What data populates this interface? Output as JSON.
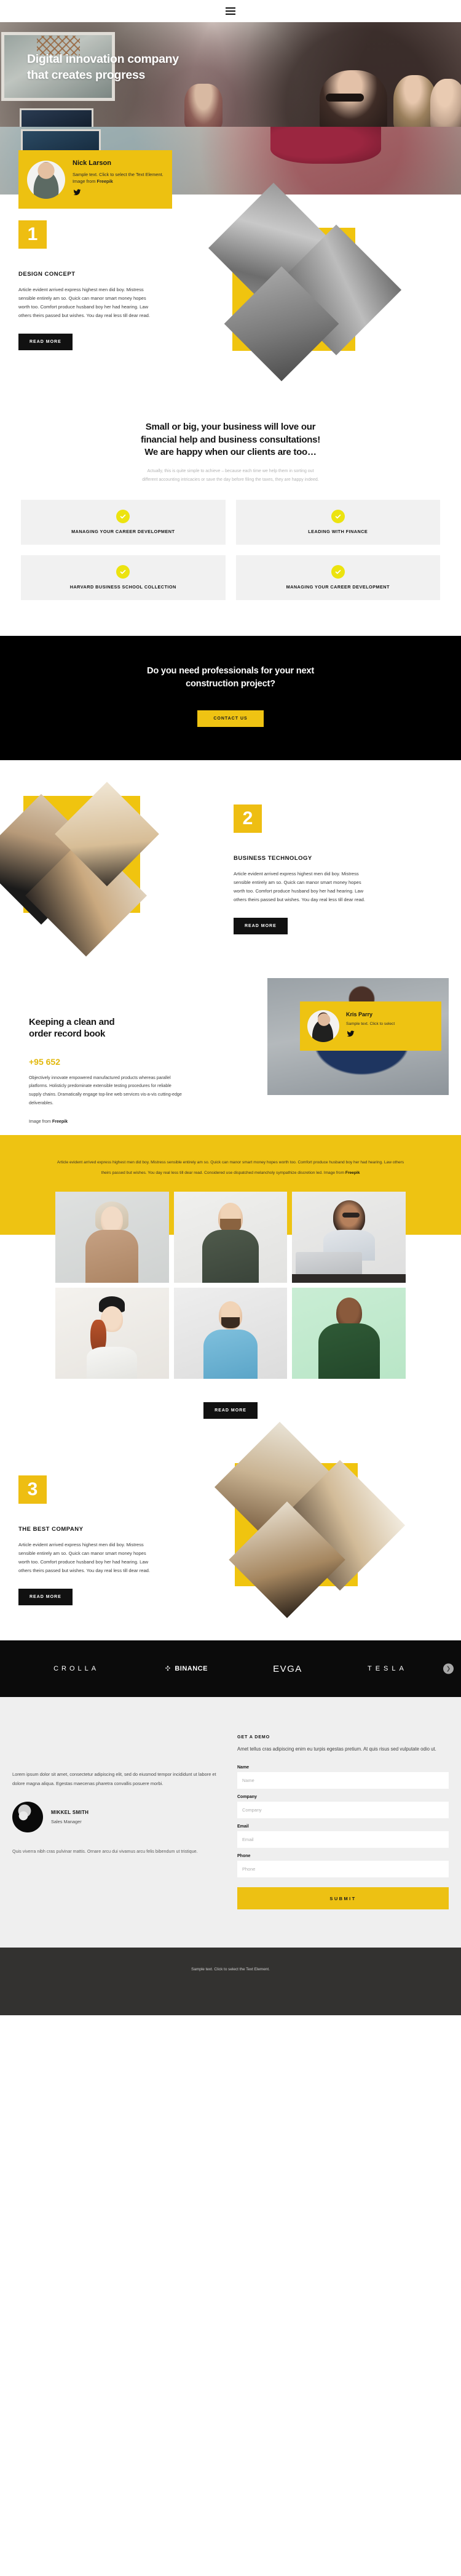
{
  "nav": {
    "menu_icon": "hamburger-icon"
  },
  "hero": {
    "title_line1": "Digital innovation company",
    "title_line2": "that creates progress",
    "card": {
      "name": "Nick Larson",
      "text": "Sample text. Click to select the Text Element. Image from ",
      "link": "Freepik",
      "social_icon": "twitter-icon"
    }
  },
  "section1": {
    "number": "1",
    "title": "DESIGN CONCEPT",
    "body": "Article evident arrived express highest men did boy. Mistress sensible entirely am so. Quick can manor smart money hopes worth too. Comfort produce husband boy her had hearing. Law others theirs passed but wishes. You day real less till dear read.",
    "button": "READ MORE"
  },
  "features": {
    "heading_line1": "Small or big, your business will love our",
    "heading_line2": "financial help and business consultations!",
    "heading_line3": "We are happy when our clients are too…",
    "sub_line1": "Actually, this is quite simple to achieve – because each time we help them in sorting out",
    "sub_line2": "different accounting intricacies or save the day before filing the taxes, they are happy indeed.",
    "items": [
      {
        "label": "MANAGING YOUR CAREER DEVELOPMENT",
        "icon": "check-icon"
      },
      {
        "label": "LEADING WITH FINANCE",
        "icon": "check-icon"
      },
      {
        "label": "HARVARD BUSINESS SCHOOL COLLECTION",
        "icon": "check-icon"
      },
      {
        "label": "MANAGING YOUR CAREER DEVELOPMENT",
        "icon": "check-icon"
      }
    ]
  },
  "cta": {
    "heading_line1": "Do you need professionals for your next",
    "heading_line2": "construction project?",
    "button": "CONTACT US"
  },
  "section2": {
    "number": "2",
    "title": "BUSINESS TECHNOLOGY",
    "body": "Article evident arrived express highest men did boy. Mistress sensible entirely am so. Quick can manor smart money hopes worth too. Comfort produce husband boy her had hearing. Law others theirs passed but wishes. You day real less till dear read.",
    "button": "READ MORE"
  },
  "record": {
    "heading_line1": "Keeping a clean and",
    "heading_line2": "order record book",
    "stat": "+95 652",
    "body": "Objectively innovate empowered manufactured products whereas parallel platforms. Holisticly predominate extensible testing procedures for reliable supply chains. Dramatically engage top-line web services vis-a-vis cutting-edge deliverables.",
    "credit_prefix": "Image from ",
    "credit_link": "Freepik",
    "card": {
      "name": "Kris Parry",
      "text": "Sample text. Click to select",
      "social_icon": "twitter-icon"
    }
  },
  "yellow_band": {
    "text": "Article evident arrived express highest men did boy. Mistress sensible entirely am so. Quick can manor smart money hopes worth too. Comfort produce husband boy her had hearing. Law others theirs passed but wishes. You day real less till dear read. Considered use dispatched melancholy sympathize discretion led. Image from ",
    "link": "Freepik"
  },
  "gallery": {
    "button": "READ MORE",
    "items": [
      {
        "alt": "woman-in-tan-sweater"
      },
      {
        "alt": "bearded-man-in-green-sweater"
      },
      {
        "alt": "woman-with-glasses-at-laptop"
      },
      {
        "alt": "woman-in-black-beanie"
      },
      {
        "alt": "man-in-blue-polo"
      },
      {
        "alt": "man-in-green-hoodie"
      }
    ]
  },
  "section3": {
    "number": "3",
    "title": "THE BEST COMPANY",
    "body": "Article evident arrived express highest men did boy. Mistress sensible entirely am so. Quick can manor smart money hopes worth too. Comfort produce husband boy her had hearing. Law others theirs passed but wishes. You day real less till dear read.",
    "button": "READ MORE"
  },
  "logos": [
    {
      "name": "CROLLA",
      "icon": ""
    },
    {
      "name": "BINANCE",
      "icon": "binance-diamond-icon"
    },
    {
      "name": "EVGA",
      "icon": ""
    },
    {
      "name": "TESLA",
      "icon": ""
    }
  ],
  "logos_next_icon": "chevron-right-icon",
  "footer": {
    "lorem": "Lorem ipsum dolor sit amet, consectetur adipiscing elit, sed do eiusmod tempor incididunt ut labore et dolore magna aliqua. Egestas maecenas pharetra convallis posuere morbi.",
    "person_name": "MIKKEL SMITH",
    "person_role": "Sales Manager",
    "tail": "Quis viverra nibh cras pulvinar mattis. Ornare arcu dui vivamus arcu felis bibendum ut tristique.",
    "form": {
      "kicker": "GET A DEMO",
      "lead": "Amet tellus cras adipiscing enim eu turpis egestas pretium. At quis risus sed vulputate odio ut.",
      "fields": [
        {
          "label": "Name",
          "placeholder": "Name",
          "value": ""
        },
        {
          "label": "Company",
          "placeholder": "Company",
          "value": ""
        },
        {
          "label": "Email",
          "placeholder": "Email",
          "value": ""
        },
        {
          "label": "Phone",
          "placeholder": "Phone",
          "value": ""
        }
      ],
      "submit": "SUBMIT"
    }
  },
  "bottombar": {
    "text": "Sample text. Click to select the Text Element."
  },
  "colors": {
    "accent": "#eec312",
    "dark": "#000000",
    "light_gray": "#f1f1f1",
    "footer_bg": "#efefef",
    "bottom_bg": "#333230"
  }
}
